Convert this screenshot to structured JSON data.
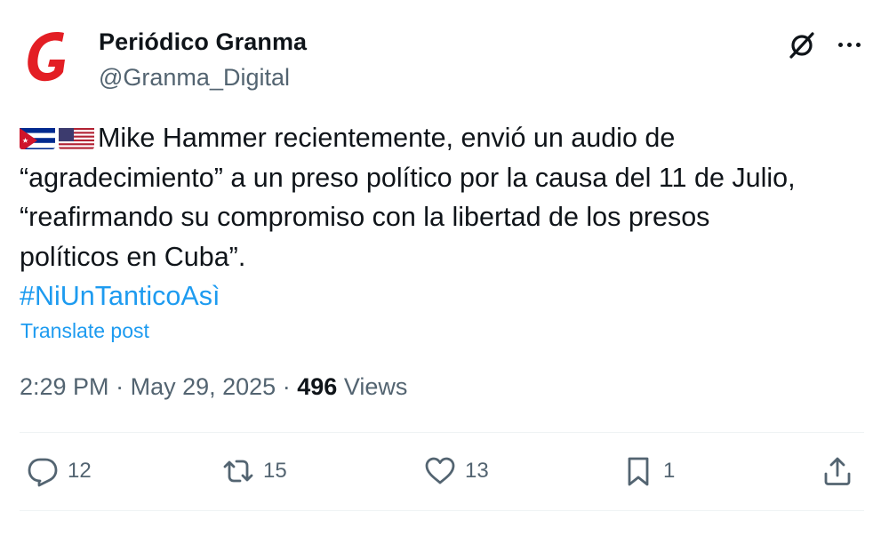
{
  "author": {
    "name": "Periódico Granma",
    "handle": "@Granma_Digital",
    "avatar_letter": "G",
    "avatar_color": "#e31e24"
  },
  "icons": {
    "grok": "grok-icon",
    "more": "more-options-icon",
    "flag_cuba": "cuba-flag-icon",
    "flag_usa": "usa-flag-icon"
  },
  "tweet": {
    "lines": [
      "Mike Hammer recientemente, envió un audio de",
      "“agradecimiento” a un preso político por la causa del 11 de Julio,",
      "“reafirmando su compromiso con la libertad de los presos",
      "políticos en Cuba”."
    ],
    "hashtag": "#NiUnTanticoAsì",
    "translate_label": "Translate post"
  },
  "meta": {
    "time": "2:29 PM",
    "separator": "·",
    "date": "May 29, 2025",
    "views_count": "496",
    "views_label": "Views"
  },
  "actions": {
    "reply_count": "12",
    "repost_count": "15",
    "like_count": "13",
    "bookmark_count": "1"
  },
  "colors": {
    "accent": "#1d9bf0",
    "secondary_text": "#536471",
    "primary_text": "#0f1419"
  }
}
